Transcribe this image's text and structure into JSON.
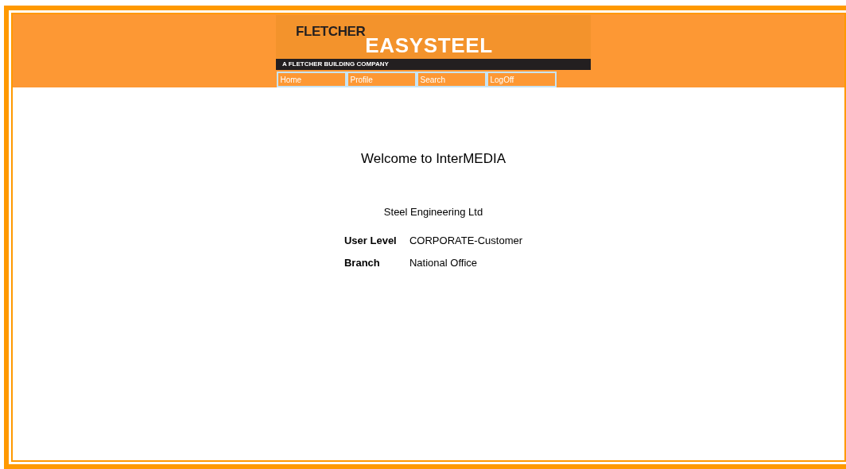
{
  "logo": {
    "brand": "FLETCHER",
    "product": "EASYSTEEL",
    "tagline": "A FLETCHER BUILDING COMPANY"
  },
  "nav": [
    {
      "label": "Home"
    },
    {
      "label": "Profile"
    },
    {
      "label": "Search"
    },
    {
      "label": "LogOff"
    }
  ],
  "welcome": "Welcome to InterMEDIA",
  "company": "Steel Engineering Ltd",
  "fields": [
    {
      "label": "User Level",
      "value": "CORPORATE-Customer"
    },
    {
      "label": "Branch",
      "value": "National Office"
    }
  ]
}
